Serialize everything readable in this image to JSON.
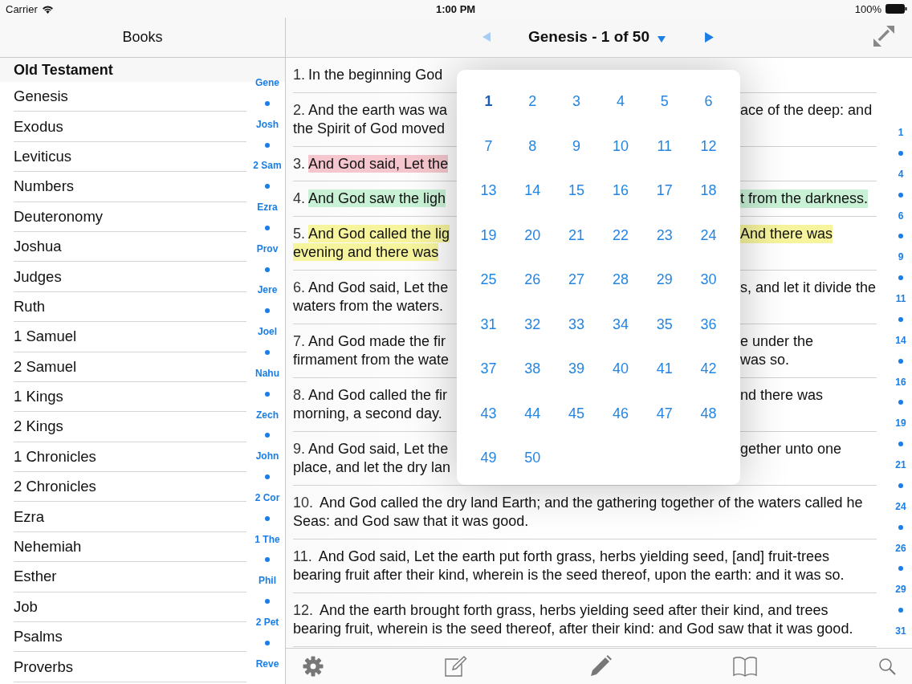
{
  "status_bar": {
    "carrier": "Carrier",
    "time": "1:00 PM",
    "battery": "100%"
  },
  "sidebar": {
    "title": "Books",
    "sections": [
      {
        "title": "Old Testament",
        "books": [
          {
            "name": "Genesis"
          },
          {
            "name": "Exodus"
          },
          {
            "name": "Leviticus"
          },
          {
            "name": "Numbers"
          },
          {
            "name": "Deuteronomy"
          },
          {
            "name": "Joshua"
          },
          {
            "name": "Judges"
          },
          {
            "name": "Ruth"
          },
          {
            "name": "1 Samuel"
          },
          {
            "name": "2 Samuel"
          },
          {
            "name": "1 Kings"
          },
          {
            "name": "2 Kings"
          },
          {
            "name": "1 Chronicles"
          },
          {
            "name": "2 Chronicles"
          },
          {
            "name": "Ezra"
          },
          {
            "name": "Nehemiah"
          },
          {
            "name": "Esther"
          },
          {
            "name": "Job"
          },
          {
            "name": "Psalms"
          },
          {
            "name": "Proverbs"
          }
        ]
      }
    ],
    "index": [
      {
        "kind": "label",
        "text": "Gene"
      },
      {
        "kind": "dot"
      },
      {
        "kind": "label",
        "text": "Josh"
      },
      {
        "kind": "dot"
      },
      {
        "kind": "label",
        "text": "2 Sam"
      },
      {
        "kind": "dot"
      },
      {
        "kind": "label",
        "text": "Ezra"
      },
      {
        "kind": "dot"
      },
      {
        "kind": "label",
        "text": "Prov"
      },
      {
        "kind": "dot"
      },
      {
        "kind": "label",
        "text": "Jere"
      },
      {
        "kind": "dot"
      },
      {
        "kind": "label",
        "text": "Joel"
      },
      {
        "kind": "dot"
      },
      {
        "kind": "label",
        "text": "Nahu"
      },
      {
        "kind": "dot"
      },
      {
        "kind": "label",
        "text": "Zech"
      },
      {
        "kind": "dot"
      },
      {
        "kind": "label",
        "text": "John"
      },
      {
        "kind": "dot"
      },
      {
        "kind": "label",
        "text": "2 Cor"
      },
      {
        "kind": "dot"
      },
      {
        "kind": "label",
        "text": "1 The"
      },
      {
        "kind": "dot"
      },
      {
        "kind": "label",
        "text": "Phil"
      },
      {
        "kind": "dot"
      },
      {
        "kind": "label",
        "text": "2 Pet"
      },
      {
        "kind": "dot"
      },
      {
        "kind": "label",
        "text": "Reve"
      }
    ]
  },
  "nav": {
    "title": "Genesis - 1 of 50",
    "prev": {
      "disabled": true
    },
    "next": {
      "disabled": false
    }
  },
  "verses": [
    {
      "number": "1.",
      "kind": "covered",
      "lines": [
        {
          "left": "In the beginning God"
        }
      ]
    },
    {
      "number": "2.",
      "kind": "covered",
      "lines": [
        {
          "left": "And the earth was wa",
          "right": "ace of the deep: and"
        },
        {
          "left": "the Spirit of God moved"
        }
      ]
    },
    {
      "number": "3.",
      "kind": "covered",
      "color": "#f5c6cd",
      "lines": [
        {
          "left": "And God said, Let the"
        }
      ]
    },
    {
      "number": "4.",
      "kind": "covered",
      "color": "#c9f1d6",
      "lines": [
        {
          "left": "And God saw the ligh",
          "right": "t from the darkness."
        }
      ]
    },
    {
      "number": "5.",
      "kind": "covered",
      "color": "#f6f49c",
      "lines": [
        {
          "left": "And God called the lig",
          "right": "And there was"
        },
        {
          "left": "evening and there was"
        }
      ]
    },
    {
      "number": "6.",
      "kind": "covered",
      "lines": [
        {
          "left": "And God said, Let the",
          "right": "s, and let it divide the"
        },
        {
          "left": "waters from the waters."
        }
      ]
    },
    {
      "number": "7.",
      "kind": "covered",
      "lines": [
        {
          "left": "And God made the fir",
          "right": "e under the"
        },
        {
          "left": "firmament from the wate",
          "right": "was so."
        }
      ]
    },
    {
      "number": "8.",
      "kind": "covered",
      "lines": [
        {
          "left": "And God called the fir",
          "right": "nd there was"
        },
        {
          "left": "morning, a second day."
        }
      ]
    },
    {
      "number": "9.",
      "kind": "covered",
      "lines": [
        {
          "left": "And God said, Let the",
          "right": "gether unto one"
        },
        {
          "left": "place, and let the dry lan"
        }
      ]
    },
    {
      "number": "10.",
      "kind": "full",
      "text": "And God called the dry land Earth; and the gathering together of the waters called he Seas: and God saw that it was good."
    },
    {
      "number": "11.",
      "kind": "full",
      "text": "And God said, Let the earth put forth grass, herbs yielding seed, [and] fruit-trees bearing fruit after their kind, wherein is the seed thereof, upon the earth: and it was so."
    },
    {
      "number": "12.",
      "kind": "full",
      "text": "And the earth brought forth grass, herbs yielding seed after their kind, and trees bearing fruit, wherein is the seed thereof, after their kind: and God saw that it was good."
    }
  ],
  "chapters": [
    {
      "label": "1",
      "selected": true
    },
    {
      "label": "2",
      "selected": false
    },
    {
      "label": "3",
      "selected": false
    },
    {
      "label": "4",
      "selected": false
    },
    {
      "label": "5",
      "selected": false
    },
    {
      "label": "6",
      "selected": false
    },
    {
      "label": "7",
      "selected": false
    },
    {
      "label": "8",
      "selected": false
    },
    {
      "label": "9",
      "selected": false
    },
    {
      "label": "10",
      "selected": false
    },
    {
      "label": "11",
      "selected": false
    },
    {
      "label": "12",
      "selected": false
    },
    {
      "label": "13",
      "selected": false
    },
    {
      "label": "14",
      "selected": false
    },
    {
      "label": "15",
      "selected": false
    },
    {
      "label": "16",
      "selected": false
    },
    {
      "label": "17",
      "selected": false
    },
    {
      "label": "18",
      "selected": false
    },
    {
      "label": "19",
      "selected": false
    },
    {
      "label": "20",
      "selected": false
    },
    {
      "label": "21",
      "selected": false
    },
    {
      "label": "22",
      "selected": false
    },
    {
      "label": "23",
      "selected": false
    },
    {
      "label": "24",
      "selected": false
    },
    {
      "label": "25",
      "selected": false
    },
    {
      "label": "26",
      "selected": false
    },
    {
      "label": "27",
      "selected": false
    },
    {
      "label": "28",
      "selected": false
    },
    {
      "label": "29",
      "selected": false
    },
    {
      "label": "30",
      "selected": false
    },
    {
      "label": "31",
      "selected": false
    },
    {
      "label": "32",
      "selected": false
    },
    {
      "label": "33",
      "selected": false
    },
    {
      "label": "34",
      "selected": false
    },
    {
      "label": "35",
      "selected": false
    },
    {
      "label": "36",
      "selected": false
    },
    {
      "label": "37",
      "selected": false
    },
    {
      "label": "38",
      "selected": false
    },
    {
      "label": "39",
      "selected": false
    },
    {
      "label": "40",
      "selected": false
    },
    {
      "label": "41",
      "selected": false
    },
    {
      "label": "42",
      "selected": false
    },
    {
      "label": "43",
      "selected": false
    },
    {
      "label": "44",
      "selected": false
    },
    {
      "label": "45",
      "selected": false
    },
    {
      "label": "46",
      "selected": false
    },
    {
      "label": "47",
      "selected": false
    },
    {
      "label": "48",
      "selected": false
    },
    {
      "label": "49",
      "selected": false
    },
    {
      "label": "50",
      "selected": false
    }
  ],
  "verse_index": [
    {
      "kind": "label",
      "text": "1"
    },
    {
      "kind": "dot"
    },
    {
      "kind": "label",
      "text": "4"
    },
    {
      "kind": "dot"
    },
    {
      "kind": "label",
      "text": "6"
    },
    {
      "kind": "dot"
    },
    {
      "kind": "label",
      "text": "9"
    },
    {
      "kind": "dot"
    },
    {
      "kind": "label",
      "text": "11"
    },
    {
      "kind": "dot"
    },
    {
      "kind": "label",
      "text": "14"
    },
    {
      "kind": "dot"
    },
    {
      "kind": "label",
      "text": "16"
    },
    {
      "kind": "dot"
    },
    {
      "kind": "label",
      "text": "19"
    },
    {
      "kind": "dot"
    },
    {
      "kind": "label",
      "text": "21"
    },
    {
      "kind": "dot"
    },
    {
      "kind": "label",
      "text": "24"
    },
    {
      "kind": "dot"
    },
    {
      "kind": "label",
      "text": "26"
    },
    {
      "kind": "dot"
    },
    {
      "kind": "label",
      "text": "29"
    },
    {
      "kind": "dot"
    },
    {
      "kind": "label",
      "text": "31"
    }
  ]
}
